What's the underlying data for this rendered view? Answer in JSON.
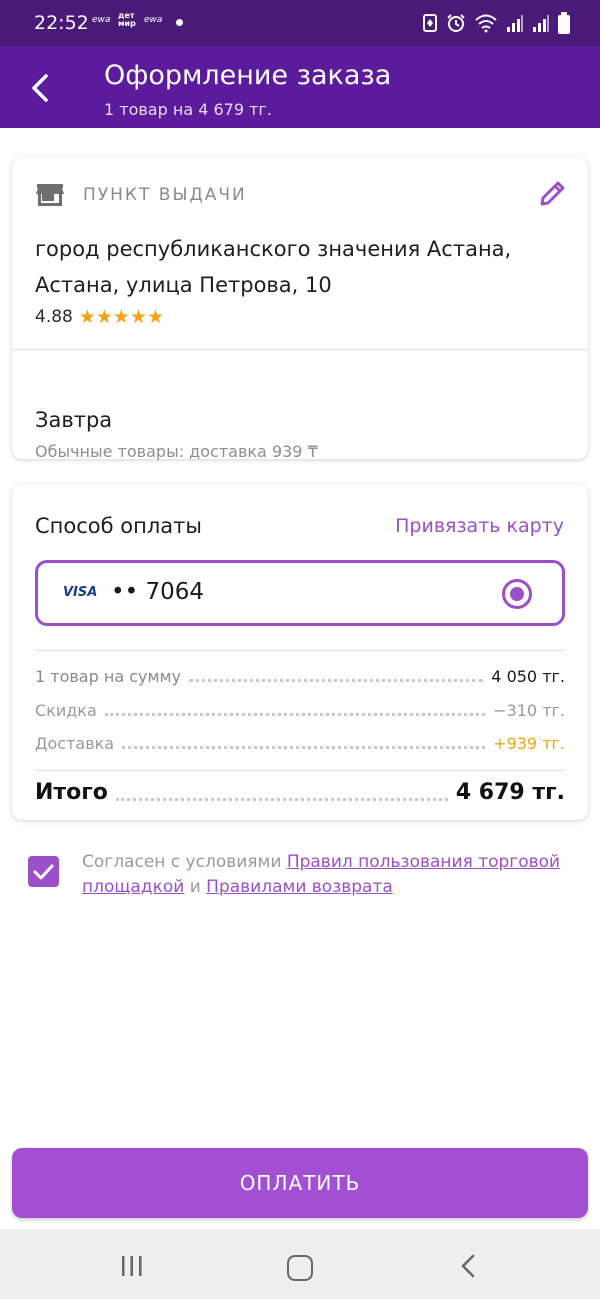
{
  "status_bar": {
    "time": "22:52",
    "notifications": [
      "ewa",
      "дет мир",
      "ewa"
    ]
  },
  "header": {
    "title": "Оформление заказа",
    "subtitle": "1 товар на 4 679 тг."
  },
  "pickup": {
    "label": "ПУНКТ ВЫДАЧИ",
    "address": "город республиканского значения Астана, Астана, улица Петрова, 10",
    "rating": "4.88",
    "stars": "★★★★★",
    "rating_value": 5,
    "delivery_day": "Завтра",
    "delivery_note": "Обычные товары: доставка 939 ₸"
  },
  "payment": {
    "title": "Способ оплаты",
    "link_card": "Привязать карту",
    "card_brand": "VISA",
    "card_number": "•• 7064",
    "selected": true
  },
  "summary": {
    "rows": [
      {
        "label": "1 товар на сумму",
        "value": "4 050 тг."
      },
      {
        "label": "Скидка",
        "value": "−310 тг."
      },
      {
        "label": "Доставка",
        "value": "+939 тг."
      }
    ],
    "total_label": "Итого",
    "total_value": "4 679 тг."
  },
  "agreement": {
    "checked": true,
    "prefix": "Согласен с условиями ",
    "link1": "Правил пользования торговой площадкой",
    "middle": " и ",
    "link2": "Правилами возврата"
  },
  "pay_button": "ОПЛАТИТЬ",
  "colors": {
    "status_bar": "#4a1a78",
    "header": "#5b1b9c",
    "accent": "#9b4fc9",
    "button": "#a24fd3",
    "stars": "#f3a316"
  }
}
